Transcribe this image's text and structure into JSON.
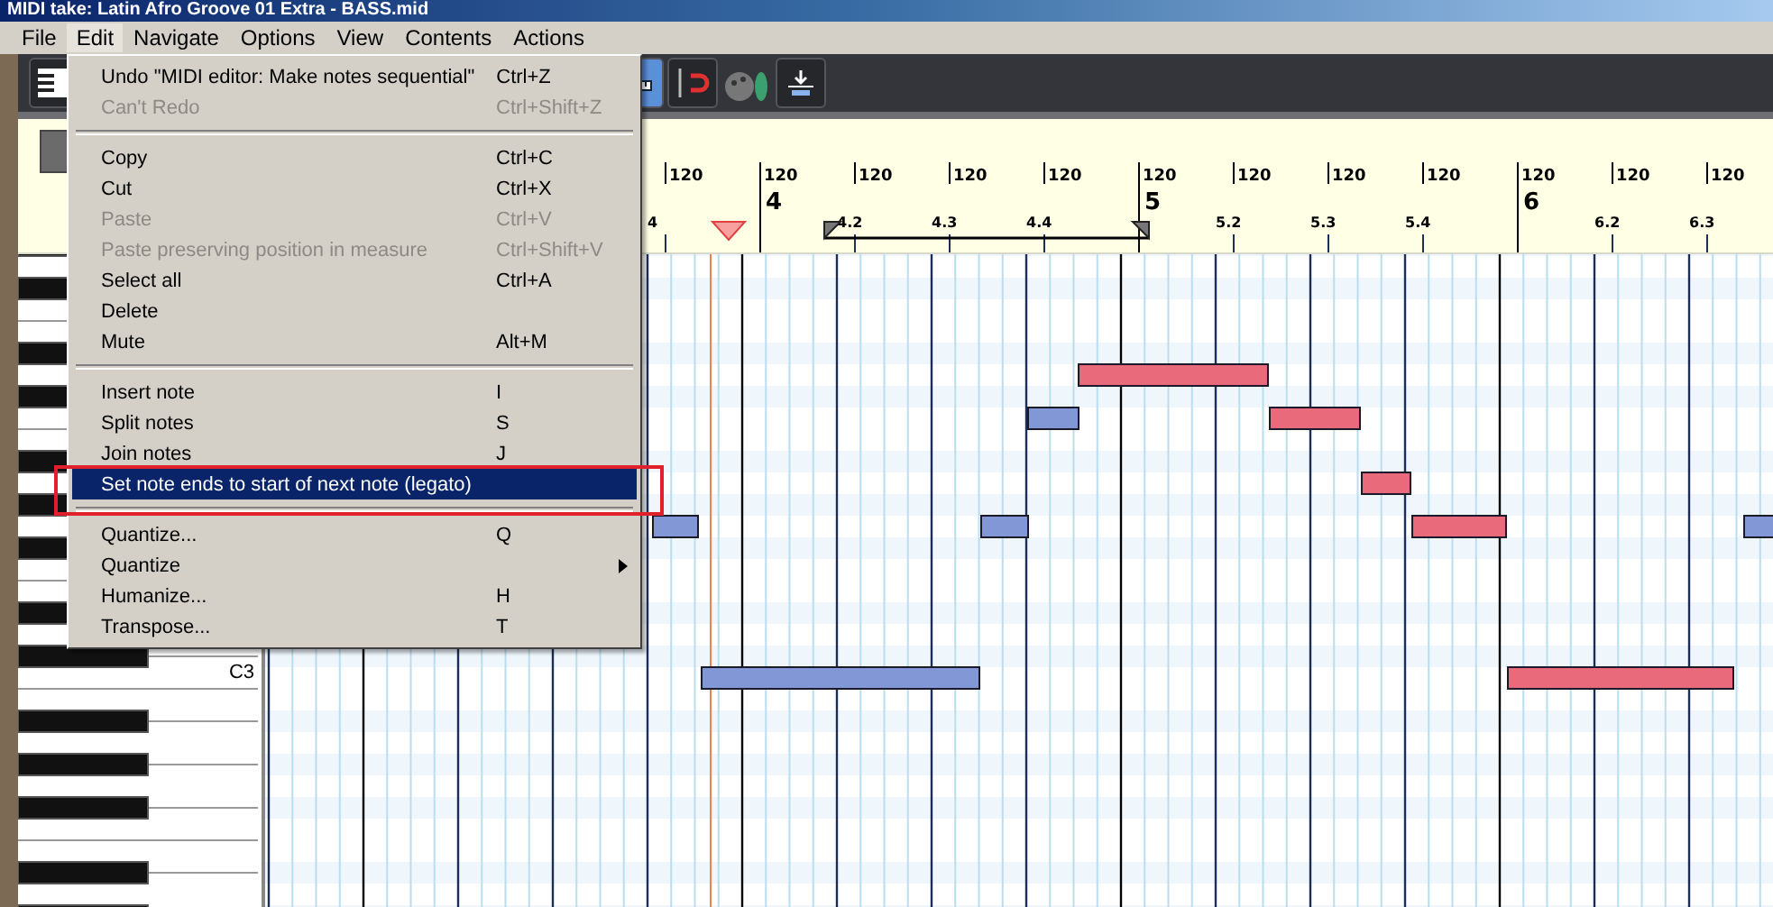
{
  "window": {
    "title": "MIDI take: Latin Afro Groove 01 Extra - BASS.mid"
  },
  "menu_bar": [
    {
      "label": "File",
      "selected": false
    },
    {
      "label": "Edit",
      "selected": true
    },
    {
      "label": "Navigate",
      "selected": false
    },
    {
      "label": "Options",
      "selected": false
    },
    {
      "label": "View",
      "selected": false
    },
    {
      "label": "Contents",
      "selected": false
    },
    {
      "label": "Actions",
      "selected": false
    }
  ],
  "edit_menu": [
    {
      "kind": "item",
      "label": "Undo \"MIDI editor: Make notes sequential\"",
      "shortcut": "Ctrl+Z",
      "disabled": false,
      "selected": false,
      "submenu": false
    },
    {
      "kind": "item",
      "label": "Can't Redo",
      "shortcut": "Ctrl+Shift+Z",
      "disabled": true,
      "selected": false,
      "submenu": false
    },
    {
      "kind": "separator"
    },
    {
      "kind": "item",
      "label": "Copy",
      "shortcut": "Ctrl+C",
      "disabled": false,
      "selected": false,
      "submenu": false
    },
    {
      "kind": "item",
      "label": "Cut",
      "shortcut": "Ctrl+X",
      "disabled": false,
      "selected": false,
      "submenu": false
    },
    {
      "kind": "item",
      "label": "Paste",
      "shortcut": "Ctrl+V",
      "disabled": true,
      "selected": false,
      "submenu": false
    },
    {
      "kind": "item",
      "label": "Paste preserving position in measure",
      "shortcut": "Ctrl+Shift+V",
      "disabled": true,
      "selected": false,
      "submenu": false
    },
    {
      "kind": "item",
      "label": "Select all",
      "shortcut": "Ctrl+A",
      "disabled": false,
      "selected": false,
      "submenu": false
    },
    {
      "kind": "item",
      "label": "Delete",
      "disabled": false,
      "selected": false,
      "submenu": false
    },
    {
      "kind": "item",
      "label": "Mute",
      "shortcut": "Alt+M",
      "disabled": false,
      "selected": false,
      "submenu": false
    },
    {
      "kind": "separator"
    },
    {
      "kind": "item",
      "label": "Insert note",
      "shortcut": "I",
      "disabled": false,
      "selected": false,
      "submenu": false
    },
    {
      "kind": "item",
      "label": "Split notes",
      "shortcut": "S",
      "disabled": false,
      "selected": false,
      "submenu": false
    },
    {
      "kind": "item",
      "label": "Join notes",
      "shortcut": "J",
      "disabled": false,
      "selected": false,
      "submenu": false
    },
    {
      "kind": "item",
      "label": "Set note ends to start of next note (legato)",
      "disabled": false,
      "selected": true,
      "submenu": false
    },
    {
      "kind": "separator"
    },
    {
      "kind": "item",
      "label": "Quantize...",
      "shortcut": "Q",
      "disabled": false,
      "selected": false,
      "submenu": false
    },
    {
      "kind": "item",
      "label": "Quantize",
      "disabled": false,
      "selected": false,
      "submenu": true
    },
    {
      "kind": "item",
      "label": "Humanize...",
      "shortcut": "H",
      "disabled": false,
      "selected": false,
      "submenu": false
    },
    {
      "kind": "item",
      "label": "Transpose...",
      "shortcut": "T",
      "disabled": false,
      "selected": false,
      "submenu": false
    }
  ],
  "ruler": {
    "beats": [
      {
        "kind": "beat",
        "tempo": "120",
        "label": "4"
      },
      {
        "kind": "measure",
        "tempo": "120",
        "label": "4"
      },
      {
        "kind": "beat",
        "tempo": "120",
        "label": "4.2"
      },
      {
        "kind": "beat",
        "tempo": "120",
        "label": "4.3"
      },
      {
        "kind": "beat",
        "tempo": "120",
        "label": "4.4"
      },
      {
        "kind": "measure",
        "tempo": "120",
        "label": "5"
      },
      {
        "kind": "beat",
        "tempo": "120",
        "label": "5.2"
      },
      {
        "kind": "beat",
        "tempo": "120",
        "label": "5.3"
      },
      {
        "kind": "beat",
        "tempo": "120",
        "label": "5.4"
      },
      {
        "kind": "measure",
        "tempo": "120",
        "label": "6"
      },
      {
        "kind": "beat",
        "tempo": "120",
        "label": "6.2"
      },
      {
        "kind": "beat",
        "tempo": "120",
        "label": "6.3"
      }
    ]
  },
  "piano": {
    "label": "C3"
  },
  "notes": [
    {
      "selected": true
    },
    {
      "selected": false
    },
    {
      "selected": true
    },
    {
      "selected": true
    },
    {
      "selected": false
    },
    {
      "selected": false
    },
    {
      "selected": true
    },
    {
      "selected": false
    },
    {
      "selected": false
    },
    {
      "selected": true
    }
  ]
}
